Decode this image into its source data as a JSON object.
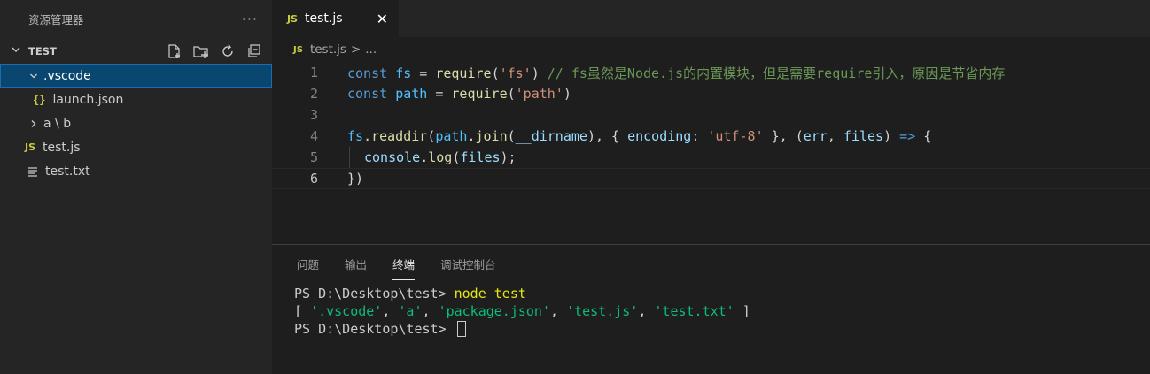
{
  "sidebar": {
    "title": "资源管理器",
    "more": "···",
    "section_label": "TEST",
    "tree": [
      {
        "label": ".vscode",
        "twisty": "v"
      },
      {
        "label": "launch.json",
        "icon": "{}"
      },
      {
        "label": "a \\ b",
        "twisty": ">"
      },
      {
        "label": "test.js",
        "icon": "JS"
      },
      {
        "label": "test.txt",
        "icon": "lines"
      }
    ]
  },
  "editor": {
    "tab": {
      "icon": "JS",
      "name": "test.js",
      "close": "✕"
    },
    "breadcrumb": {
      "icon": "JS",
      "file": "test.js",
      "sep": ">",
      "more": "..."
    },
    "line_numbers": [
      "1",
      "2",
      "3",
      "4",
      "5",
      "6"
    ],
    "code": [
      {
        "kw": "const",
        "var": "fs",
        "op": " = ",
        "fn": "require",
        "p1": "(",
        "str": "'fs'",
        "p2": ")",
        "comment": " // fs虽然是Node.js的内置模块，但是需要require引入，原因是节省内存"
      },
      {
        "kw": "const",
        "var": "path",
        "op": " = ",
        "fn": "require",
        "p1": "(",
        "str": "'path'",
        "p2": ")"
      },
      {},
      {
        "obj1": "fs",
        "dot1": ".",
        "fn1": "readdir",
        "p1": "(",
        "obj2": "path",
        "dot2": ".",
        "fn2": "join",
        "p2": "(",
        "arg1": "__dirname",
        "p3": "), { ",
        "key": "encoding",
        "colon": ": ",
        "str": "'utf-8'",
        "p4": " }, (",
        "arg2": "err",
        "comma": ", ",
        "arg3": "files",
        "p5": ") ",
        "arrow": "=>",
        "p6": " {"
      },
      {
        "obj": "console",
        "dot": ".",
        "fn": "log",
        "p1": "(",
        "arg": "files",
        "p2": ");"
      },
      {
        "close": "})"
      }
    ]
  },
  "panel": {
    "tabs": [
      "问题",
      "输出",
      "终端",
      "调试控制台"
    ],
    "active_tab": "终端",
    "terminal": {
      "line1_prompt": "PS D:\\Desktop\\test> ",
      "line1_cmd": "node test",
      "line2_open": "[ ",
      "line2_items": [
        "'.vscode'",
        "'a'",
        "'package.json'",
        "'test.js'",
        "'test.txt'"
      ],
      "line2_sep": ", ",
      "line2_close": " ]",
      "line3_prompt": "PS D:\\Desktop\\test> "
    }
  },
  "colors": {
    "sidebar_bg": "#252526",
    "editor_bg": "#1e1e1e",
    "selection": "#094771",
    "keyword": "#569cd6",
    "string": "#ce9178",
    "comment": "#6a9955",
    "function": "#dcdcaa",
    "terminal_string": "#0dbc79",
    "terminal_command": "#e5e510"
  }
}
